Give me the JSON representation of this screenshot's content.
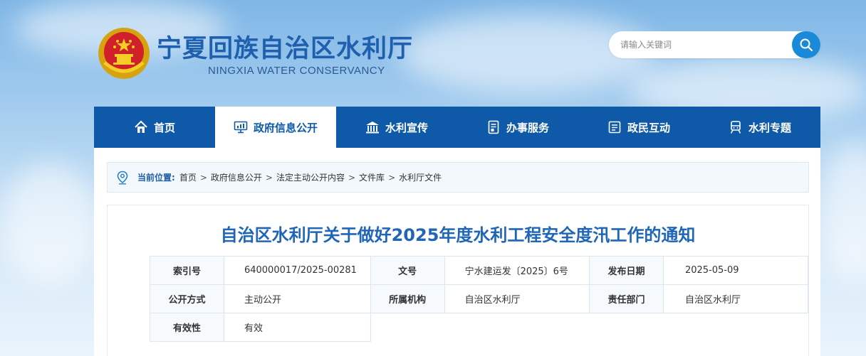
{
  "header": {
    "title": "宁夏回族自治区水利厅",
    "subtitle": "NINGXIA WATER CONSERVANCY",
    "search_placeholder": "请输入关键词",
    "search_icon": "search-icon"
  },
  "nav": {
    "items": [
      {
        "label": "首页",
        "icon": "home-icon"
      },
      {
        "label": "政府信息公开",
        "icon": "monitor-icon",
        "active": true
      },
      {
        "label": "水利宣传",
        "icon": "building-icon"
      },
      {
        "label": "办事服务",
        "icon": "document-icon"
      },
      {
        "label": "政民互动",
        "icon": "list-icon"
      },
      {
        "label": "水利专题",
        "icon": "train-icon"
      }
    ]
  },
  "breadcrumb": {
    "label": "当前位置:",
    "items": [
      "首页",
      "政府信息公开",
      "法定主动公开内容",
      "文件库",
      "水利厅文件"
    ],
    "separator": ">"
  },
  "article": {
    "title": "自治区水利厅关于做好2025年度水利工程安全度汛工作的通知",
    "meta": {
      "index_no_label": "索引号",
      "index_no": "640000017/2025-00281",
      "doc_no_label": "文号",
      "doc_no": "宁水建运发〔2025〕6号",
      "date_label": "发布日期",
      "date": "2025-05-09",
      "disclosure_label": "公开方式",
      "disclosure": "主动公开",
      "org_label": "所属机构",
      "org": "自治区水利厅",
      "dept_label": "责任部门",
      "dept": "自治区水利厅",
      "validity_label": "有效性",
      "validity": "有效"
    }
  },
  "colors": {
    "brand": "#1e5fae",
    "nav_bg": "#0f5aa8",
    "title": "#1f66b8",
    "search_button": "#1a8ad8"
  }
}
